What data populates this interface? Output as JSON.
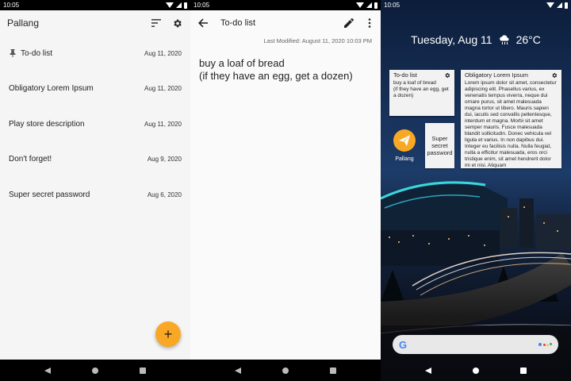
{
  "status": {
    "time": "10:05"
  },
  "list_screen": {
    "title": "Pallang",
    "notes": [
      {
        "title": "To-do list",
        "date": "Aug 11, 2020",
        "pinned": true
      },
      {
        "title": "Obligatory Lorem Ipsum",
        "date": "Aug 11, 2020",
        "pinned": false
      },
      {
        "title": "Play store description",
        "date": "Aug 11, 2020",
        "pinned": false
      },
      {
        "title": "Don't forget!",
        "date": "Aug 9, 2020",
        "pinned": false
      },
      {
        "title": "Super secret password",
        "date": "Aug 6, 2020",
        "pinned": false
      }
    ],
    "fab_label": "+"
  },
  "editor_screen": {
    "title": "To-do list",
    "last_modified": "Last Modified: August 11, 2020 10:03 PM",
    "body_lines": [
      "buy a loaf of bread",
      "(if they have an egg, get a dozen)"
    ]
  },
  "home_screen": {
    "date": "Tuesday, Aug 11",
    "temperature": "26°C",
    "widgets": {
      "todo": {
        "title": "To-do list",
        "lines": [
          "buy a loaf of bread",
          "(if they have an egg, get",
          "a dozen)"
        ]
      },
      "lorem": {
        "title": "Obligatory Lorem Ipsum",
        "body": "Lorem ipsum dolor sit amet, consectetur adipiscing elit. Phasellus varius, ex venenatis tempus viverra, neque dui ornare purus, sit amet malesuada magna tortor ut libero. Mauris sapien dui, iaculis sed convallis pellentesque, interdum et magna. Morbi sit amet semper mauris. Fusce malesuada blandit sollicitudin. Donec vehicula vel ligula et varius. In non dapibus dui. Integer eu facilisis nulla. Nulla feugiat, nulla a efficitur malesuada, eros orci tristique enim, sit amet hendrerit dolor mi et nisi. Aliquam"
      },
      "secret": {
        "lines": [
          "Super",
          "secret",
          "password"
        ]
      }
    },
    "app_label": "Pallang",
    "search_logo": "G"
  },
  "colors": {
    "accent": "#f9a825",
    "status_bar": "#000000",
    "list_background": "#f5f5f5"
  },
  "icons": {
    "sort": "sort-icon",
    "settings": "gear-icon",
    "pin": "pin-icon",
    "back": "arrow-back-icon",
    "edit": "pencil-icon",
    "more": "more-vert-icon",
    "weather": "cloud-rain-icon"
  }
}
